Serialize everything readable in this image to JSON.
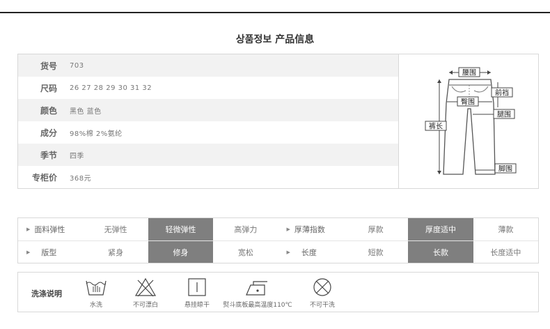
{
  "header": {
    "title_main": "상품정보",
    "title_sub": "产品信息"
  },
  "spec": {
    "rows": [
      {
        "label": "货号",
        "value": "703"
      },
      {
        "label": "尺码",
        "value": "26 27 28 29 30 31 32"
      },
      {
        "label": "颜色",
        "value": "黑色  蓝色"
      },
      {
        "label": "成分",
        "value": "98%棉 2%氨纶"
      },
      {
        "label": "季节",
        "value": "四季"
      },
      {
        "label": "专柜价",
        "value": "368元"
      }
    ],
    "diagram_labels": {
      "waist": "腰围",
      "front_rise": "前裆",
      "hip": "臀围",
      "thigh": "腿围",
      "length": "裤长",
      "hem": "脚围"
    }
  },
  "attributes": {
    "row1": {
      "head1": "面料弹性",
      "opts1": [
        "无弹性",
        "轻微弹性",
        "高弹力"
      ],
      "selected1": 1,
      "head2": "厚薄指数",
      "opts2": [
        "厚款",
        "厚度适中",
        "薄款"
      ],
      "selected2": 1
    },
    "row2": {
      "head1": "版型",
      "opts1": [
        "紧身",
        "修身",
        "宽松"
      ],
      "selected1": 1,
      "head2": "长度",
      "opts2": [
        "短款",
        "长款",
        "长度适中"
      ],
      "selected2": 1
    }
  },
  "wash": {
    "title": "洗涤说明",
    "icons": [
      {
        "icon": "hand-wash-icon",
        "caption": "水洗"
      },
      {
        "icon": "no-bleach-icon",
        "caption": "不可漂白"
      },
      {
        "icon": "hang-dry-icon",
        "caption": "悬挂晾干"
      },
      {
        "icon": "iron-icon",
        "caption": "熨斗底板最高温度110℃"
      },
      {
        "icon": "no-dry-clean-icon",
        "caption": "不可干洗"
      }
    ]
  }
}
